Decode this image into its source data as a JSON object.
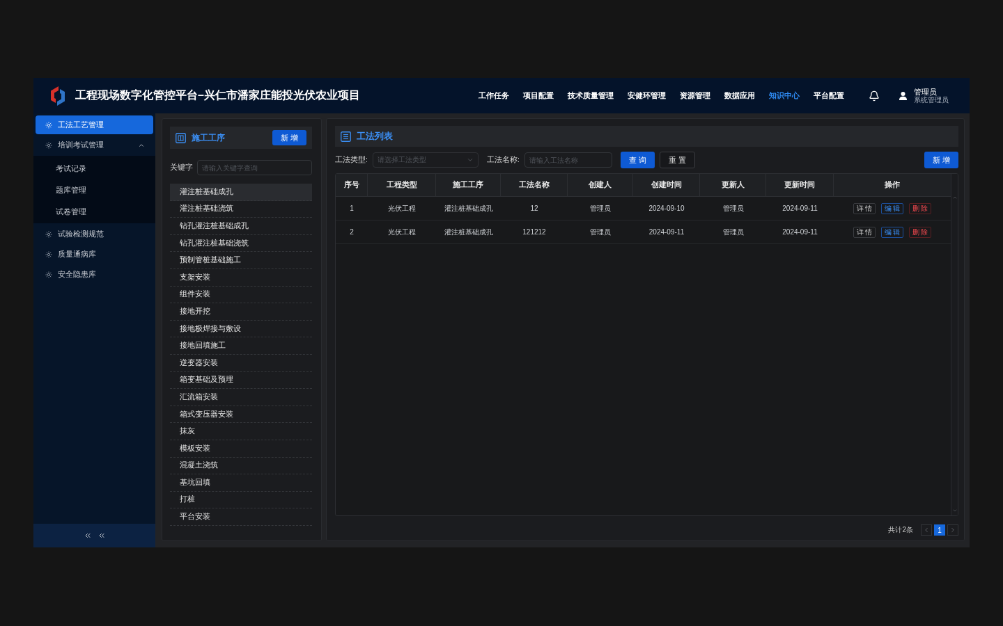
{
  "header": {
    "title": "工程现场数字化管控平台–兴仁市潘家庄能投光伏农业项目",
    "nav": [
      {
        "label": "工作任务",
        "selected": false
      },
      {
        "label": "项目配置",
        "selected": false
      },
      {
        "label": "技术质量管理",
        "selected": false
      },
      {
        "label": "安健环管理",
        "selected": false
      },
      {
        "label": "资源管理",
        "selected": false
      },
      {
        "label": "数据应用",
        "selected": false
      },
      {
        "label": "知识中心",
        "selected": true
      },
      {
        "label": "平台配置",
        "selected": false
      }
    ],
    "user": {
      "name": "管理员",
      "role": "系统管理员"
    }
  },
  "sidebar": {
    "items": [
      {
        "label": "工法工艺管理",
        "selected": true
      },
      {
        "label": "培训考试管理",
        "selected": false,
        "expanded": true,
        "children": [
          {
            "label": "考试记录",
            "selected": false
          },
          {
            "label": "题库管理",
            "selected": false
          },
          {
            "label": "试卷管理",
            "selected": false
          }
        ]
      },
      {
        "label": "试验检测规范",
        "selected": false
      },
      {
        "label": "质量通病库",
        "selected": false
      },
      {
        "label": "安全隐患库",
        "selected": false
      }
    ]
  },
  "process_panel": {
    "title": "施工工序",
    "add_button": "新增",
    "keyword": {
      "label": "关键字",
      "placeholder": "请输入关键字查询"
    },
    "items": [
      {
        "label": "灌注桩基础成孔",
        "selected": true
      },
      {
        "label": "灌注桩基础浇筑",
        "selected": false
      },
      {
        "label": "钻孔灌注桩基础成孔",
        "selected": false
      },
      {
        "label": "钻孔灌注桩基础浇筑",
        "selected": false
      },
      {
        "label": "预制管桩基础施工",
        "selected": false
      },
      {
        "label": "支架安装",
        "selected": false
      },
      {
        "label": "组件安装",
        "selected": false
      },
      {
        "label": "接地开挖",
        "selected": false
      },
      {
        "label": "接地极焊接与敷设",
        "selected": false
      },
      {
        "label": "接地回填施工",
        "selected": false
      },
      {
        "label": "逆变器安装",
        "selected": false
      },
      {
        "label": "箱变基础及预埋",
        "selected": false
      },
      {
        "label": "汇流箱安装",
        "selected": false
      },
      {
        "label": "箱式变压器安装",
        "selected": false
      },
      {
        "label": "抹灰",
        "selected": false
      },
      {
        "label": "模板安装",
        "selected": false
      },
      {
        "label": "混凝土浇筑",
        "selected": false
      },
      {
        "label": "基坑回填",
        "selected": false
      },
      {
        "label": "打桩",
        "selected": false
      },
      {
        "label": "平台安装",
        "selected": false
      }
    ]
  },
  "method_panel": {
    "title": "工法列表",
    "filters": [
      {
        "kind": "select",
        "label": "工法类型:",
        "placeholder": "请选择工法类型"
      },
      {
        "kind": "input",
        "label": "工法名称:",
        "placeholder": "请输入工法名称"
      }
    ],
    "search_button": "查询",
    "reset_button": "重置",
    "add_button": "新增",
    "table": {
      "columns": [
        "序号",
        "工程类型",
        "施工工序",
        "工法名称",
        "创建人",
        "创建时间",
        "更新人",
        "更新时间",
        "操作"
      ],
      "rows": [
        {
          "cells": [
            "1",
            "光伏工程",
            "灌注桩基础成孔",
            "12",
            "管理员",
            "2024-09-10",
            "管理员",
            "2024-09-11"
          ],
          "actions": [
            {
              "kind": "view",
              "label": "详情"
            },
            {
              "kind": "edit",
              "label": "编辑"
            },
            {
              "kind": "delete",
              "label": "删除"
            }
          ]
        },
        {
          "cells": [
            "2",
            "光伏工程",
            "灌注桩基础成孔",
            "121212",
            "管理员",
            "2024-09-11",
            "管理员",
            "2024-09-11"
          ],
          "actions": [
            {
              "kind": "view",
              "label": "详情"
            },
            {
              "kind": "edit",
              "label": "编辑"
            },
            {
              "kind": "delete",
              "label": "删除"
            }
          ]
        }
      ]
    },
    "pagination": {
      "total": "共计2条",
      "pages": [
        {
          "label": "1",
          "selected": true
        }
      ]
    }
  }
}
